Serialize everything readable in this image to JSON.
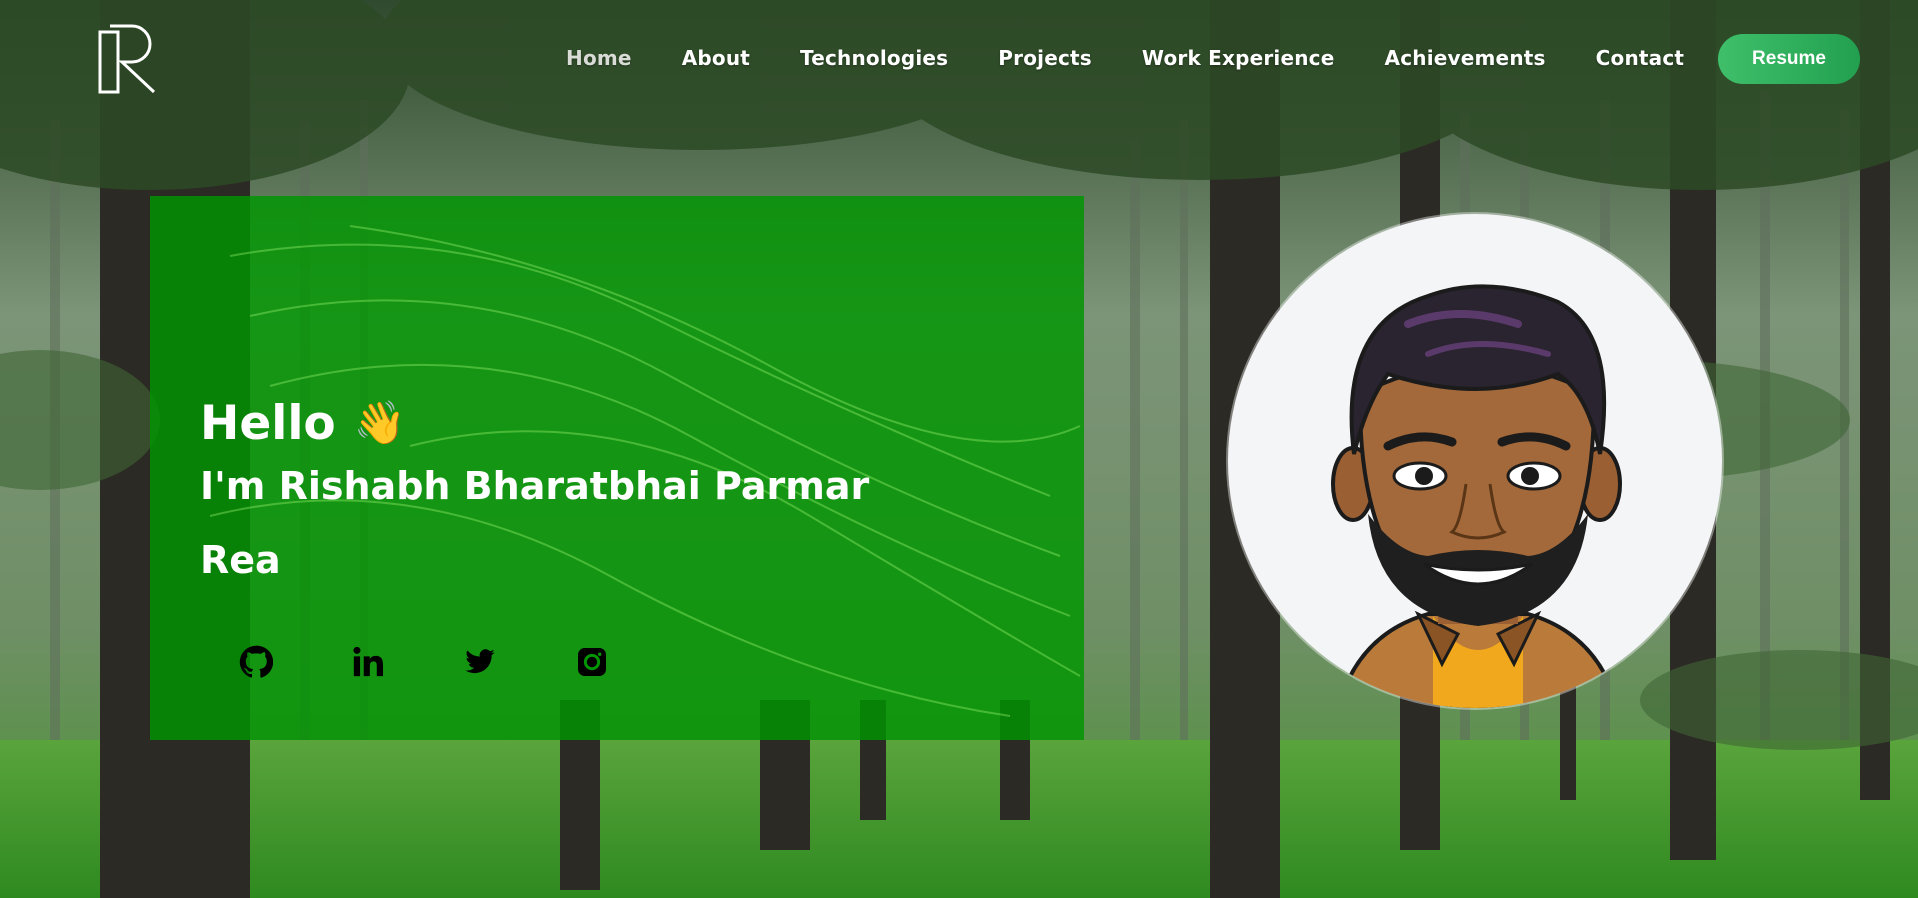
{
  "nav": {
    "logo_icon": "r-monogram-logo",
    "links": [
      {
        "label": "Home",
        "active": true
      },
      {
        "label": "About"
      },
      {
        "label": "Technologies"
      },
      {
        "label": "Projects"
      },
      {
        "label": "Work Experience"
      },
      {
        "label": "Achievements"
      },
      {
        "label": "Contact"
      }
    ],
    "resume_label": "Resume"
  },
  "hero": {
    "greeting": "Hello",
    "wave_icon": "waving-hand-icon",
    "wave_glyph": "👋",
    "name": "I'm Rishabh Bharatbhai Parmar",
    "typed_text": "Rea",
    "socials": [
      {
        "name": "github",
        "icon": "github-icon"
      },
      {
        "name": "linkedin",
        "icon": "linkedin-icon"
      },
      {
        "name": "twitter",
        "icon": "twitter-icon"
      },
      {
        "name": "instagram",
        "icon": "instagram-icon"
      }
    ]
  },
  "avatar": {
    "icon": "bitmoji-avatar"
  },
  "colors": {
    "card_green": "#009600",
    "resume_gradient_start": "#3fbf6a",
    "resume_gradient_end": "#22a050",
    "text": "#ffffff"
  }
}
